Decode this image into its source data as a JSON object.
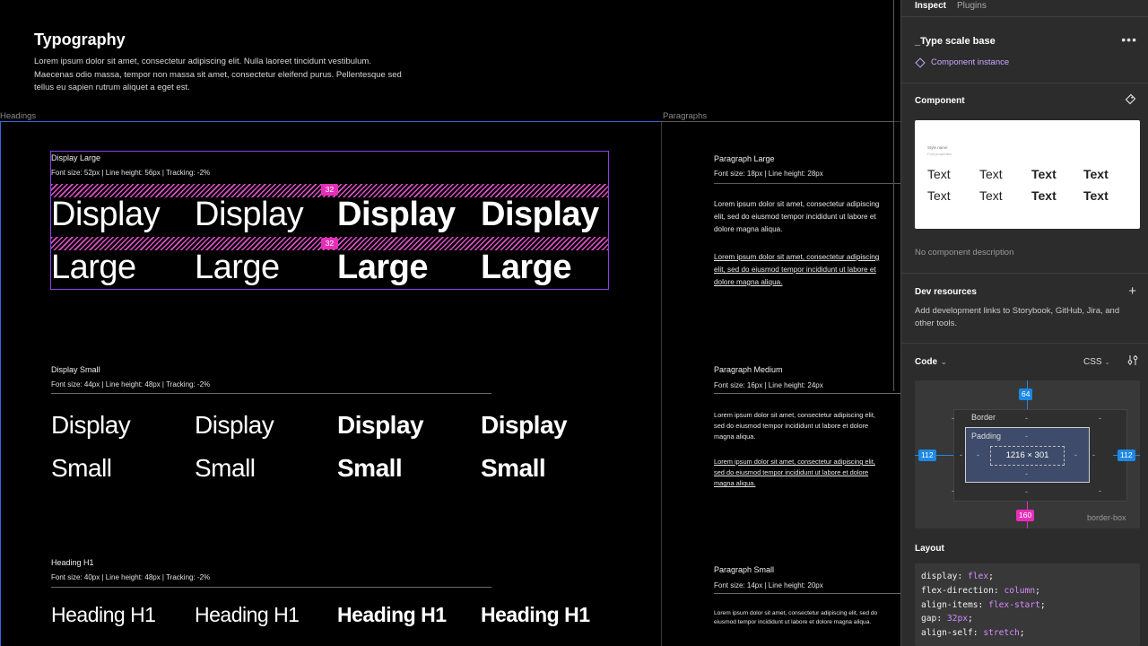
{
  "canvas": {
    "intro": {
      "title": "Typography",
      "body": "Lorem ipsum dolor sit amet, consectetur adipiscing elit. Nulla laoreet tincidunt vestibulum. Maecenas odio massa, tempor non massa sit amet, consectetur eleifend purus. Pellentesque sed tellus eu sapien rutrum aliquet a eget est."
    },
    "frames": {
      "headings_label": "Headings",
      "paragraphs_label": "Paragraphs"
    },
    "display_large": {
      "name": "Display Large",
      "meta": "Font size: 52px | Line height: 56px | Tracking: -2%",
      "line1": "Display",
      "line2": "Large",
      "spacing_top": "32",
      "spacing_mid": "32"
    },
    "display_small": {
      "name": "Display Small",
      "meta": "Font size: 44px | Line height: 48px | Tracking: -2%",
      "line1": "Display",
      "line2": "Small"
    },
    "heading_h1": {
      "name": "Heading H1",
      "meta": "Font size: 40px | Line height: 48px | Tracking: -2%",
      "line1": "Heading H1"
    },
    "paragraph_large": {
      "name": "Paragraph Large",
      "meta": "Font size: 18px | Line height: 28px",
      "text": "Lorem ipsum dolor sit amet, consectetur adipiscing elit, sed do eiusmod tempor incididunt ut labore et dolore magna aliqua.",
      "link_text": "Lorem ipsum dolor sit amet, consectetur adipiscing elit, sed do eiusmod tempor incididunt ut labore et dolore magna aliqua."
    },
    "paragraph_medium": {
      "name": "Paragraph Medium",
      "meta": "Font size: 16px | Line height: 24px",
      "text": "Lorem ipsum dolor sit amet, consectetur adipiscing elit, sed do eiusmod tempor incididunt ut labore et dolore magna aliqua.",
      "link_text": "Lorem ipsum dolor sit amet, consectetur adipiscing elit, sed do eiusmod tempor incididunt ut labore et dolore magna aliqua."
    },
    "paragraph_small": {
      "name": "Paragraph Small",
      "meta": "Font size: 14px | Line height: 20px",
      "text": "Lorem ipsum dolor sit amet, consectetur adipiscing elit, sed do eiusmod tempor incididunt ut labore et dolore magna aliqua."
    }
  },
  "panel": {
    "tabs": [
      "Inspect",
      "Plugins"
    ],
    "component_name": "_Type scale base",
    "instance_label": "Component instance",
    "component_section": "Component",
    "preview": {
      "style_name": "Style name",
      "font_properties": "Font properties",
      "sample": "Text"
    },
    "no_description": "No component description",
    "dev_resources": {
      "title": "Dev resources",
      "text": "Add development links to Storybook, GitHub, Jira, and other tools."
    },
    "code": {
      "title": "Code",
      "language": "CSS"
    },
    "box_model": {
      "margin_top": "64",
      "margin_left": "112",
      "margin_right": "112",
      "margin_bottom": "160",
      "border_label": "Border",
      "padding_label": "Padding",
      "size": "1216 × 301",
      "dash": "-",
      "box_sizing": "border-box"
    },
    "layout": {
      "title": "Layout",
      "lines": [
        {
          "prop": "display",
          "value": "flex"
        },
        {
          "prop": "flex-direction",
          "value": "column"
        },
        {
          "prop": "align-items",
          "value": "flex-start"
        },
        {
          "prop": "gap",
          "value": "32px"
        },
        {
          "prop": "align-self",
          "value": "stretch"
        }
      ]
    },
    "icons": {
      "more": "more-icon",
      "component": "diamond-icon",
      "detach": "detach-icon",
      "add": "plus-icon",
      "settings": "sliders-icon"
    }
  }
}
